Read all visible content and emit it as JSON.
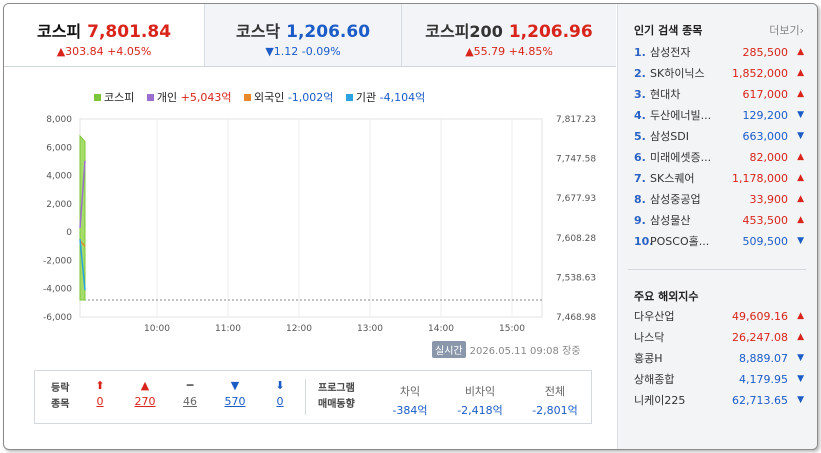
{
  "indices": [
    {
      "name": "코스피",
      "value": "7,801.84",
      "change": "303.84 +4.05%",
      "dir": "up"
    },
    {
      "name": "코스닥",
      "value": "1,206.60",
      "change": "1.12 -0.09%",
      "dir": "dn"
    },
    {
      "name": "코스피200",
      "value": "1,206.96",
      "change": "55.79 +4.85%",
      "dir": "up"
    }
  ],
  "legend": [
    {
      "name": "코스피",
      "value": "",
      "color": "#7bc63a"
    },
    {
      "name": "개인",
      "value": "+5,043억",
      "color": "#9b6fd0"
    },
    {
      "name": "외국인",
      "value": "-1,002억",
      "color": "#e9882a"
    },
    {
      "name": "기관",
      "value": "-4,104억",
      "color": "#2aa3e0"
    }
  ],
  "chart_data": {
    "type": "line",
    "left_axis": [
      "8,000",
      "6,000",
      "4,000",
      "2,000",
      "0",
      "-2,000",
      "-4,000",
      "-6,000"
    ],
    "right_axis": [
      "7,817.23",
      "7,747.58",
      "7,677.93",
      "7,608.28",
      "7,538.63",
      "7,468.98"
    ],
    "x_ticks": [
      "10:00",
      "11:00",
      "12:00",
      "13:00",
      "14:00",
      "15:00"
    ],
    "ylim": [
      -6000,
      8000
    ],
    "series": [
      {
        "name": "코스피",
        "points": [
          [
            0,
            6800
          ],
          [
            5,
            6400
          ]
        ]
      },
      {
        "name": "개인",
        "points": [
          [
            0,
            300
          ],
          [
            5,
            5043
          ]
        ]
      },
      {
        "name": "외국인",
        "points": [
          [
            0,
            -600
          ],
          [
            5,
            -1002
          ]
        ]
      },
      {
        "name": "기관",
        "points": [
          [
            0,
            -500
          ],
          [
            5,
            -4104
          ]
        ]
      }
    ],
    "baseline": -4800
  },
  "realtime_badge": "실시간",
  "timestamp": "2026.05.11 09:08",
  "market_status": "장중",
  "stats": {
    "label1": "등락",
    "label2": "종목",
    "counts": [
      {
        "icon": "⬆",
        "value": "0",
        "color": "#d9241b"
      },
      {
        "icon": "▲",
        "value": "270",
        "color": "#d9241b"
      },
      {
        "icon": "━",
        "value": "46",
        "color": "#666"
      },
      {
        "icon": "▼",
        "value": "570",
        "color": "#1c5cc7"
      },
      {
        "icon": "⬇",
        "value": "0",
        "color": "#1c5cc7"
      }
    ],
    "program_label1": "프로그램",
    "program_label2": "매매동향",
    "program": [
      {
        "head": "차익",
        "value": "-384억"
      },
      {
        "head": "비차익",
        "value": "-2,418억"
      },
      {
        "head": "전체",
        "value": "-2,801억"
      }
    ]
  },
  "popular": {
    "title": "인기 검색 종목",
    "more": "더보기",
    "items": [
      {
        "rank": "1.",
        "name": "삼성전자",
        "price": "285,500",
        "dir": "up"
      },
      {
        "rank": "2.",
        "name": "SK하이닉스",
        "price": "1,852,000",
        "dir": "up"
      },
      {
        "rank": "3.",
        "name": "현대차",
        "price": "617,000",
        "dir": "up"
      },
      {
        "rank": "4.",
        "name": "두산에너빌...",
        "price": "129,200",
        "dir": "dn"
      },
      {
        "rank": "5.",
        "name": "삼성SDI",
        "price": "663,000",
        "dir": "dn"
      },
      {
        "rank": "6.",
        "name": "미래에셋증...",
        "price": "82,000",
        "dir": "up"
      },
      {
        "rank": "7.",
        "name": "SK스퀘어",
        "price": "1,178,000",
        "dir": "up"
      },
      {
        "rank": "8.",
        "name": "삼성중공업",
        "price": "33,900",
        "dir": "up"
      },
      {
        "rank": "9.",
        "name": "삼성물산",
        "price": "453,500",
        "dir": "up"
      },
      {
        "rank": "10.",
        "name": "POSCO홀...",
        "price": "509,500",
        "dir": "dn"
      }
    ]
  },
  "overseas": {
    "title": "주요 해외지수",
    "items": [
      {
        "name": "다우산업",
        "price": "49,609.16",
        "dir": "up"
      },
      {
        "name": "나스닥",
        "price": "26,247.08",
        "dir": "up"
      },
      {
        "name": "홍콩H",
        "price": "8,889.07",
        "dir": "dn"
      },
      {
        "name": "상해종합",
        "price": "4,179.95",
        "dir": "dn"
      },
      {
        "name": "니케이225",
        "price": "62,713.65",
        "dir": "dn"
      }
    ]
  }
}
